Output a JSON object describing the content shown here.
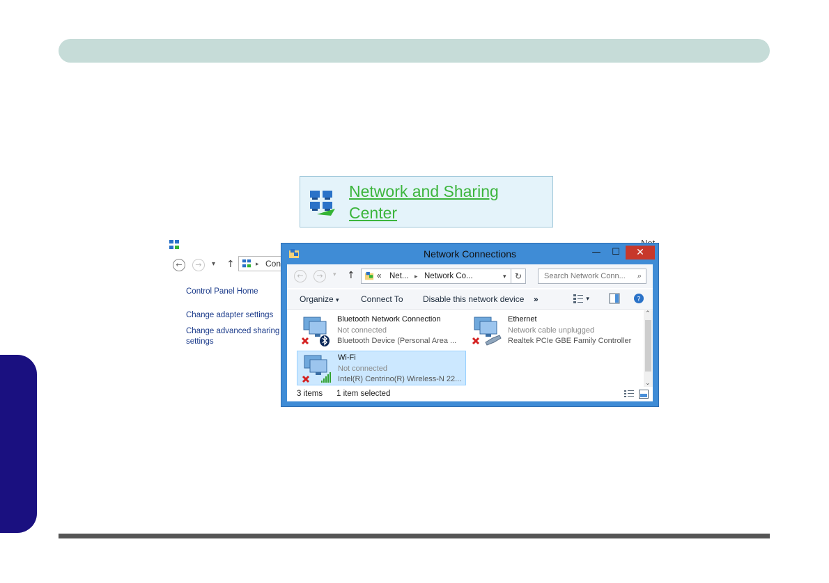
{
  "nsc_link": {
    "line1": "Network and Sharing",
    "line2": "Center"
  },
  "background_window": {
    "title_partial": "Net",
    "address_partial": "Con",
    "links": [
      "Control Panel Home",
      "Change adapter settings",
      "Change advanced sharing",
      "settings"
    ]
  },
  "window": {
    "title": "Network Connections",
    "minimize": "—",
    "maximize": "☐",
    "close": "✕"
  },
  "nav": {
    "address_chevron": "«",
    "address_part1": "Net...",
    "address_sep": "▸",
    "address_part2": "Network Co...",
    "search_placeholder": "Search Network Conn..."
  },
  "toolbar": {
    "organize": "Organize",
    "connect_to": "Connect To",
    "disable": "Disable this network device",
    "more": "»"
  },
  "items": [
    {
      "name": "Bluetooth Network Connection",
      "status": "Not connected",
      "device": "Bluetooth Device (Personal Area ..."
    },
    {
      "name": "Ethernet",
      "status": "Network cable unplugged",
      "device": "Realtek PCIe GBE Family Controller"
    },
    {
      "name": "Wi-Fi",
      "status": "Not connected",
      "device": "Intel(R) Centrino(R) Wireless-N 22..."
    }
  ],
  "status_bar": {
    "count": "3 items",
    "selected": "1 item selected"
  },
  "colors": {
    "header_bar": "#c6dcd8",
    "side_tab": "#1a1080",
    "link_green": "#3cb53c",
    "window_frame": "#3f8cd6",
    "close_button": "#c7382b",
    "selection": "#cce8ff"
  }
}
